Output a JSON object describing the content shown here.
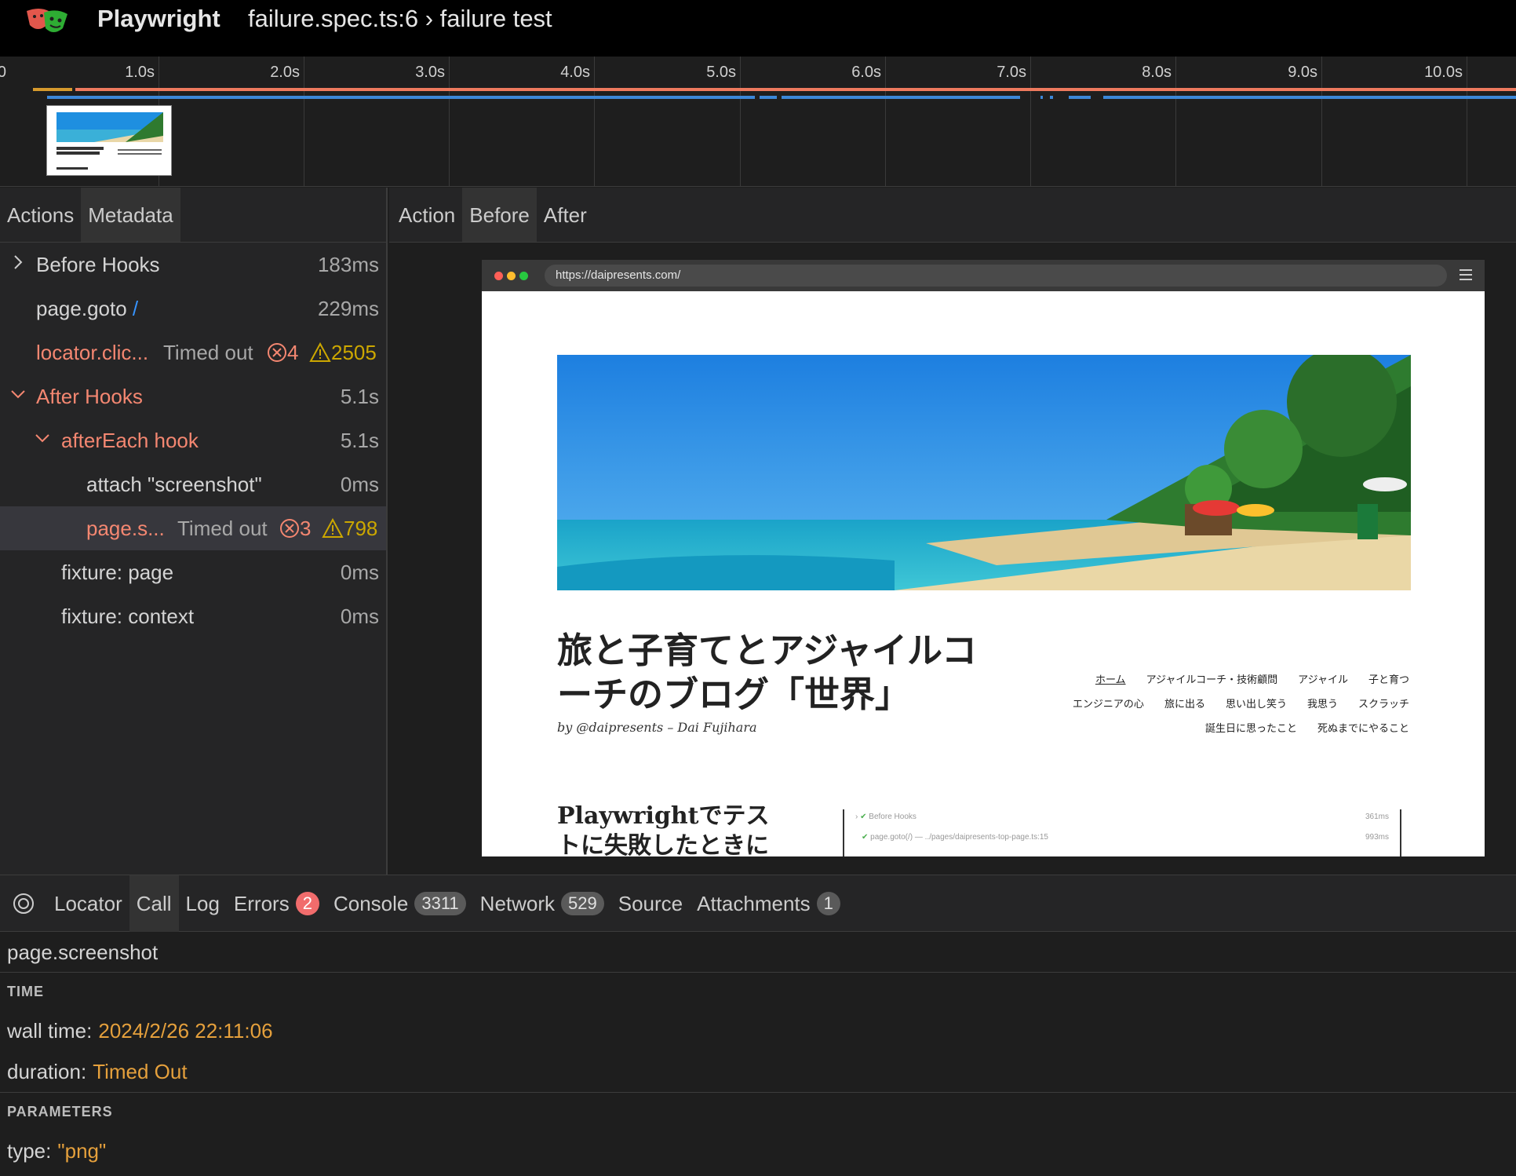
{
  "header": {
    "app_title": "Playwright",
    "test_title": "failure.spec.ts:6 › failure test"
  },
  "timeline": {
    "ticks": [
      "0",
      "1.0s",
      "2.0s",
      "3.0s",
      "4.0s",
      "5.0s",
      "6.0s",
      "7.0s",
      "8.0s",
      "9.0s",
      "10.0s"
    ]
  },
  "left_tabs": [
    "Actions",
    "Metadata"
  ],
  "actions": [
    {
      "label": "Before Hooks",
      "duration": "183ms",
      "expanded": false
    },
    {
      "label": "page.goto",
      "link": "/",
      "duration": "229ms"
    },
    {
      "label": "locator.clic...",
      "status": "Timed out",
      "errors": "4",
      "warnings": "2505"
    },
    {
      "label": "After Hooks",
      "duration": "5.1s",
      "expanded": true
    },
    {
      "label": "afterEach hook",
      "duration": "5.1s",
      "expanded": true
    },
    {
      "label": "attach \"screenshot\"",
      "duration": "0ms"
    },
    {
      "label": "page.s...",
      "status": "Timed out",
      "errors": "3",
      "warnings": "798"
    },
    {
      "label": "fixture: page",
      "duration": "0ms"
    },
    {
      "label": "fixture: context",
      "duration": "0ms"
    }
  ],
  "right_tabs": [
    "Action",
    "Before",
    "After"
  ],
  "snapshot": {
    "url": "https://daipresents.com/",
    "site_title": "旅と子育てとアジャイルコーチのブログ「世界」",
    "site_subtitle": "by @daipresents – Dai Fujihara",
    "nav": [
      "ホーム",
      "アジャイルコーチ・技術顧問",
      "アジャイル",
      "子と育つ",
      "エンジニアの心",
      "旅に出る",
      "思い出し笑う",
      "我思う",
      "スクラッチ",
      "誕生日に思ったこと",
      "死ぬまでにやること"
    ],
    "post_title": "Playwrightでテストに失敗したときに",
    "mini_trace": [
      {
        "label": "Before Hooks",
        "duration": "361ms"
      },
      {
        "label": "page.goto(/) — ../pages/daipresents-top-page.ts:15",
        "duration": "993ms"
      }
    ]
  },
  "bottom_tabs": [
    {
      "label": "Locator"
    },
    {
      "label": "Call"
    },
    {
      "label": "Log"
    },
    {
      "label": "Errors",
      "badge": "2"
    },
    {
      "label": "Console",
      "badge": "3311"
    },
    {
      "label": "Network",
      "badge": "529"
    },
    {
      "label": "Source"
    },
    {
      "label": "Attachments",
      "badge": "1"
    }
  ],
  "call": {
    "title": "page.screenshot",
    "time_section": "TIME",
    "wall_time_label": "wall time:",
    "wall_time": "2024/2/26 22:11:06",
    "duration_label": "duration:",
    "duration": "Timed Out",
    "params_section": "PARAMETERS",
    "type_label": "type:",
    "type_value": "\"png\""
  },
  "colors": {
    "error": "#f48771",
    "accent_blue": "#3794ff",
    "value_orange": "#e5a03c",
    "warning": "#cca700"
  }
}
